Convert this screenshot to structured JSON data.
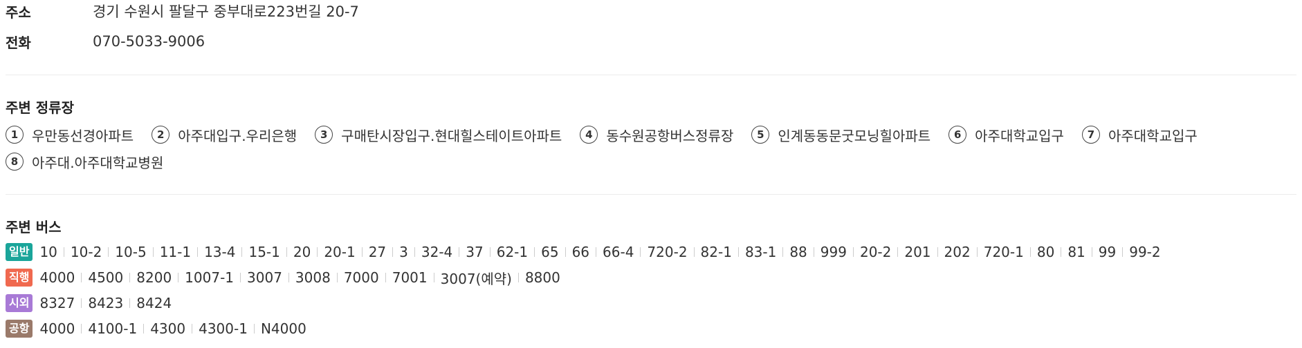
{
  "info": {
    "address_label": "주소",
    "address_value": "경기 수원시 팔달구 중부대로223번길 20-7",
    "phone_label": "전화",
    "phone_value": "070-5033-9006"
  },
  "stops": {
    "title": "주변 정류장",
    "items": [
      {
        "num": "1",
        "name": "우만동선경아파트"
      },
      {
        "num": "2",
        "name": "아주대입구.우리은행"
      },
      {
        "num": "3",
        "name": "구매탄시장입구.현대힐스테이트아파트"
      },
      {
        "num": "4",
        "name": "동수원공항버스정류장"
      },
      {
        "num": "5",
        "name": "인계동동문굿모닝힐아파트"
      },
      {
        "num": "6",
        "name": "아주대학교입구"
      },
      {
        "num": "7",
        "name": "아주대학교입구"
      },
      {
        "num": "8",
        "name": "아주대.아주대학교병원"
      }
    ]
  },
  "buses": {
    "title": "주변 버스",
    "groups": [
      {
        "type": "일반",
        "color": "#1aa59a",
        "numbers": [
          "10",
          "10-2",
          "10-5",
          "11-1",
          "13-4",
          "15-1",
          "20",
          "20-1",
          "27",
          "3",
          "32-4",
          "37",
          "62-1",
          "65",
          "66",
          "66-4",
          "720-2",
          "82-1",
          "83-1",
          "88",
          "999",
          "20-2",
          "201",
          "202",
          "720-1",
          "80",
          "81",
          "99",
          "99-2"
        ]
      },
      {
        "type": "직행",
        "color": "#f0694f",
        "numbers": [
          "4000",
          "4500",
          "8200",
          "1007-1",
          "3007",
          "3008",
          "7000",
          "7001",
          "3007(예약)",
          "8800"
        ]
      },
      {
        "type": "시외",
        "color": "#a87ad6",
        "numbers": [
          "8327",
          "8423",
          "8424"
        ]
      },
      {
        "type": "공항",
        "color": "#9a7a6a",
        "numbers": [
          "4000",
          "4100-1",
          "4300",
          "4300-1",
          "N4000"
        ]
      }
    ]
  }
}
